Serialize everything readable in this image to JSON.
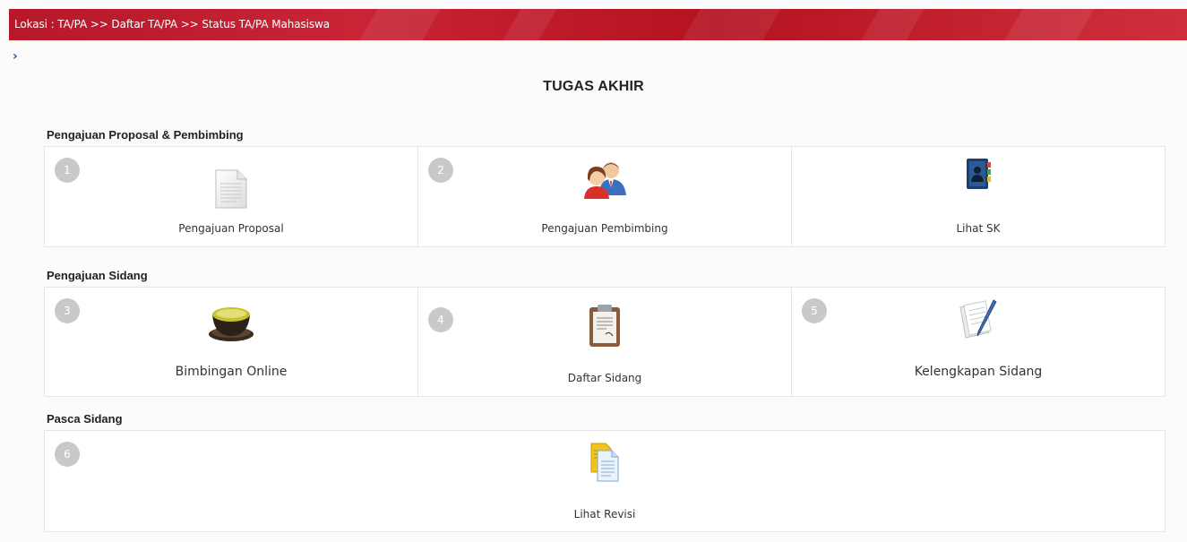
{
  "breadcrumb": "Lokasi : TA/PA >> Daftar TA/PA >> Status TA/PA Mahasiswa",
  "toggle": "›",
  "title": "TUGAS AKHIR",
  "sections": [
    {
      "title": "Pengajuan Proposal & Pembimbing",
      "items": [
        {
          "number": "1",
          "label": "Pengajuan Proposal",
          "icon": "document-icon"
        },
        {
          "number": "2",
          "label": "Pengajuan Pembimbing",
          "icon": "users-icon"
        },
        {
          "number": "",
          "label": "Lihat SK",
          "icon": "address-book-icon"
        }
      ]
    },
    {
      "title": "Pengajuan Sidang",
      "items": [
        {
          "number": "3",
          "label": "Bimbingan Online",
          "icon": "tea-cup-icon"
        },
        {
          "number": "4",
          "label": "Daftar Sidang",
          "icon": "clipboard-icon"
        },
        {
          "number": "5",
          "label": "Kelengkapan Sidang",
          "icon": "notepad-pen-icon"
        }
      ]
    },
    {
      "title": "Pasca Sidang",
      "items": [
        {
          "number": "6",
          "label": "Lihat Revisi",
          "icon": "copy-documents-icon"
        }
      ]
    }
  ],
  "colors": {
    "header": "#c0202f",
    "badge": "#c9c9c9",
    "border": "#e6e6e6"
  }
}
